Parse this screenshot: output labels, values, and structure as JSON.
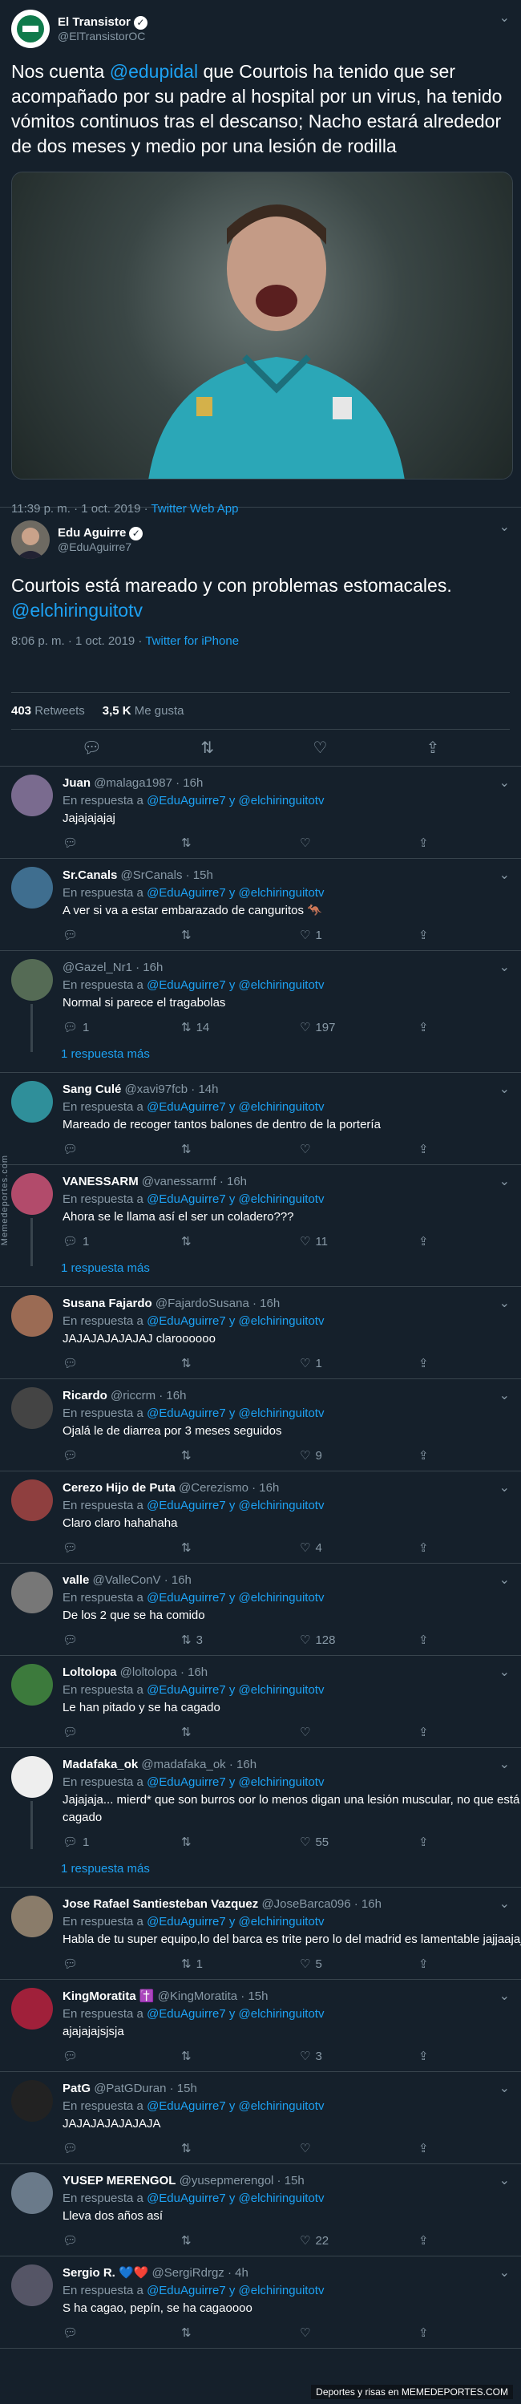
{
  "tweet1": {
    "name": "El Transistor",
    "handle": "@ElTransistorOC",
    "text_parts": [
      "Nos cuenta ",
      "@edupidal",
      " que Courtois ha tenido que ser acompañado por su padre al hospital por un virus, ha tenido vómitos continuos tras el descanso; Nacho estará alrededor de dos meses y medio por una lesión de rodilla"
    ],
    "time": "11:39 p. m. · 1 oct. 2019 · ",
    "source": "Twitter Web App"
  },
  "tweet2": {
    "name": "Edu Aguirre",
    "handle": "@EduAguirre7",
    "text": "Courtois está mareado y con problemas estomacales.",
    "mention": "@elchiringuitotv",
    "time": "8:06 p. m. · 1 oct. 2019 · ",
    "source": "Twitter for iPhone",
    "retweets": "403",
    "retweets_label": "Retweets",
    "likes": "3,5 K",
    "likes_label": "Me gusta"
  },
  "reply_prefix": "En respuesta a ",
  "reply_mentions": "@EduAguirre7 y @elchiringuitotv",
  "more_replies": "1 respuesta más",
  "replies": [
    {
      "name": "Juan",
      "handle": "@malaga1987 · 16h",
      "text": "Jajajajajaj",
      "replies": "",
      "rts": "",
      "likes": ""
    },
    {
      "name": "Sr.Canals",
      "handle": "@SrCanals · 15h",
      "text": "A ver si va a estar embarazado de canguritos 🦘",
      "replies": "",
      "rts": "",
      "likes": "1"
    },
    {
      "name": "",
      "handle": "@Gazel_Nr1 · 16h",
      "text": "Normal si parece el tragabolas",
      "replies": "1",
      "rts": "14",
      "likes": "197"
    },
    {
      "name": "Sang Culé",
      "handle": "@xavi97fcb · 14h",
      "text": "Mareado de recoger tantos balones de dentro de la portería",
      "replies": "",
      "rts": "",
      "likes": ""
    },
    {
      "name": "VANESSARM",
      "handle": "@vanessarmf · 16h",
      "text": "Ahora se le llama así el ser un coladero???",
      "replies": "1",
      "rts": "",
      "likes": "11"
    },
    {
      "name": "Susana Fajardo",
      "handle": "@FajardoSusana · 16h",
      "text": "JAJAJAJAJAJAJ claroooooo",
      "replies": "",
      "rts": "",
      "likes": "1"
    },
    {
      "name": "Ricardo",
      "handle": "@riccrm · 16h",
      "text": "Ojalá le de diarrea por 3 meses seguidos",
      "replies": "",
      "rts": "",
      "likes": "9"
    },
    {
      "name": "Cerezo Hijo de Puta",
      "handle": "@Cerezismo · 16h",
      "text": "Claro claro hahahaha",
      "replies": "",
      "rts": "",
      "likes": "4"
    },
    {
      "name": "valle",
      "handle": "@ValleConV · 16h",
      "text": "De los 2 que se ha comido",
      "replies": "",
      "rts": "3",
      "likes": "128"
    },
    {
      "name": "Loltolopa",
      "handle": "@loltolopa · 16h",
      "text": "Le han pitado y se ha cagado",
      "replies": "",
      "rts": "",
      "likes": ""
    },
    {
      "name": "Madafaka_ok",
      "handle": "@madafaka_ok · 16h",
      "text": "Jajajaja... mierd* que son burros oor lo menos digan una lesión muscular, no que está cagado",
      "replies": "1",
      "rts": "",
      "likes": "55"
    },
    {
      "name": "Jose Rafael Santiesteban Vazquez",
      "handle": "@JoseBarca096 · 16h",
      "text": "Habla de tu super equipo,lo del barca es trite pero lo del madrid es lamentable jajjaajaj",
      "replies": "",
      "rts": "1",
      "likes": "5"
    },
    {
      "name": "KingMoratita ✝️",
      "handle": "@KingMoratita · 15h",
      "text": "ajajajajsjsja",
      "replies": "",
      "rts": "",
      "likes": "3"
    },
    {
      "name": "PatG",
      "handle": "@PatGDuran · 15h",
      "text": "JAJAJAJAJAJAJA",
      "replies": "",
      "rts": "",
      "likes": ""
    },
    {
      "name": "YUSEP MERENGOL",
      "handle": "@yusepmerengol · 15h",
      "text": "Lleva dos años así",
      "replies": "",
      "rts": "",
      "likes": "22"
    },
    {
      "name": "Sergio R. 💙❤️",
      "handle": "@SergiRdrgz · 4h",
      "text": "S ha cagao, pepín, se ha cagaoooo",
      "replies": "",
      "rts": "",
      "likes": ""
    }
  ],
  "watermark": "Memedeportes.com",
  "footer": "Deportes y risas en MEMEDEPORTES.COM",
  "colors": {
    "background": "#15202b",
    "accent": "#1da1f2",
    "muted": "#8899a6",
    "divider": "#38444d"
  }
}
